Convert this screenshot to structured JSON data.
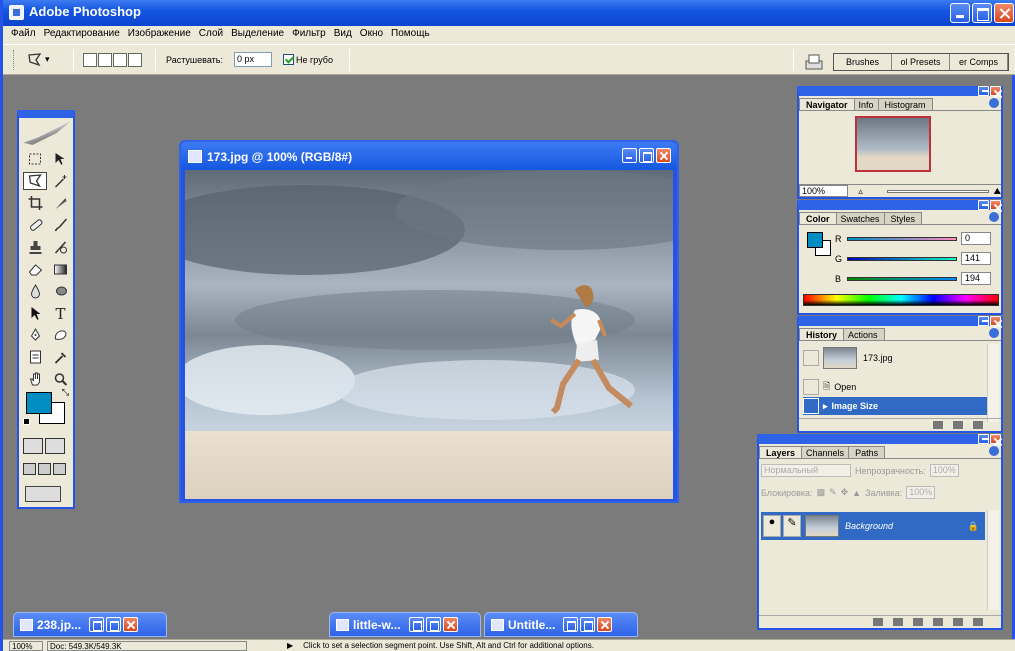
{
  "app": {
    "title": "Adobe Photoshop"
  },
  "menu": [
    "Файл",
    "Редактирование",
    "Изображение",
    "Слой",
    "Выделение",
    "Фильтр",
    "Вид",
    "Окно",
    "Помощь"
  ],
  "options": {
    "feather_label": "Растушевать:",
    "feather_value": "0 px",
    "antialias_label": "Не грубо",
    "well_tabs": [
      "Brushes",
      "ol Presets",
      "er Comps"
    ]
  },
  "document": {
    "title": "173.jpg @ 100% (RGB/8#)"
  },
  "navigator": {
    "tabs": [
      "Navigator",
      "Info",
      "Histogram"
    ],
    "zoom": "100%"
  },
  "color": {
    "tabs": [
      "Color",
      "Swatches",
      "Styles"
    ],
    "fg_color": "#008dc2",
    "channels": [
      {
        "label": "R",
        "value": "0"
      },
      {
        "label": "G",
        "value": "141"
      },
      {
        "label": "B",
        "value": "194"
      }
    ]
  },
  "history": {
    "tabs": [
      "History",
      "Actions"
    ],
    "snapshot": "173.jpg",
    "items": [
      "Open",
      "Image Size"
    ]
  },
  "layers": {
    "tabs": [
      "Layers",
      "Channels",
      "Paths"
    ],
    "blend_mode": "Нормальный",
    "opacity_label": "Непрозрачность:",
    "opacity_value": "100%",
    "lock_label": "Блокировка:",
    "fill_label": "Заливка:",
    "fill_value": "100%",
    "layer_name": "Background"
  },
  "taskbar": [
    "238.jp...",
    "little-w...",
    "Untitle..."
  ],
  "status": {
    "zoom": "100%",
    "doc": "Doc: 549.3K/549.3K",
    "hint": "Click to set a selection segment point. Use Shift, Alt and Ctrl for additional options."
  }
}
